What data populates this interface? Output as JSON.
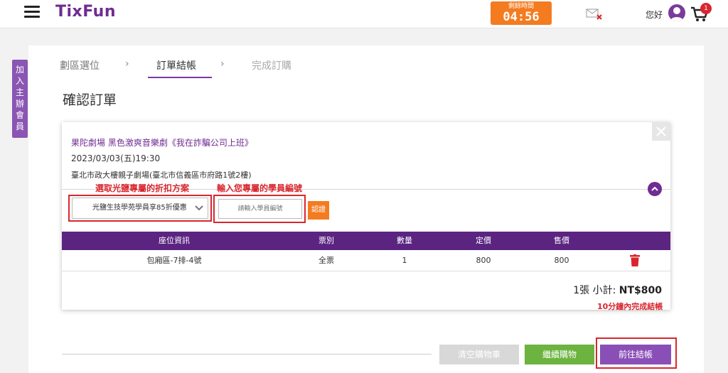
{
  "header": {
    "logo": "TixFun",
    "timer_label": "剩餘時間",
    "timer_value": "04:56",
    "greeting": "您好",
    "cart_count": "1",
    "icons": [
      "menu-icon",
      "mail-error-icon",
      "user-avatar-icon",
      "cart-icon"
    ]
  },
  "sidebar": {
    "join_label": "加入主辦會員"
  },
  "steps": {
    "items": [
      "劃區選位",
      "訂單結帳",
      "完成訂購"
    ],
    "separator": "›",
    "active_index": 1
  },
  "page_title": "確認訂單",
  "event": {
    "title": "果陀劇場 黑色激爽音樂劇《我在詐騙公司上班》",
    "date": "2023/03/03(五)19:30",
    "venue": "臺北市政大樓親子劇場(臺北市信義區市府路1號2樓)"
  },
  "annotations": {
    "discount_hint": "選取光鹽專屬的折扣方案",
    "member_hint": "輸入您專屬的學員編號",
    "time_note": "10分鐘內完成結帳"
  },
  "discount": {
    "selected": "光鹽生技學苑學員享85折優惠"
  },
  "member_input": {
    "placeholder": "請輸入學員編號"
  },
  "verify_label": "認證",
  "table": {
    "headers": [
      "座位資訊",
      "票別",
      "數量",
      "定價",
      "售價"
    ],
    "rows": [
      {
        "seat": "包廂區-7排-4號",
        "ticket_type": "全票",
        "qty": "1",
        "list_price": "800",
        "price": "800"
      }
    ]
  },
  "subtotal": {
    "count_label": "1張 小計:",
    "amount": "NT$800"
  },
  "buttons": {
    "clear": "清空購物車",
    "continue": "繼續購物",
    "checkout": "前往結帳"
  },
  "colors": {
    "brand": "#6f2c91",
    "accent_orange": "#f47b20",
    "annotation_red": "#d9262e",
    "continue_green": "#6cb33f",
    "table_head": "#5b2481"
  }
}
